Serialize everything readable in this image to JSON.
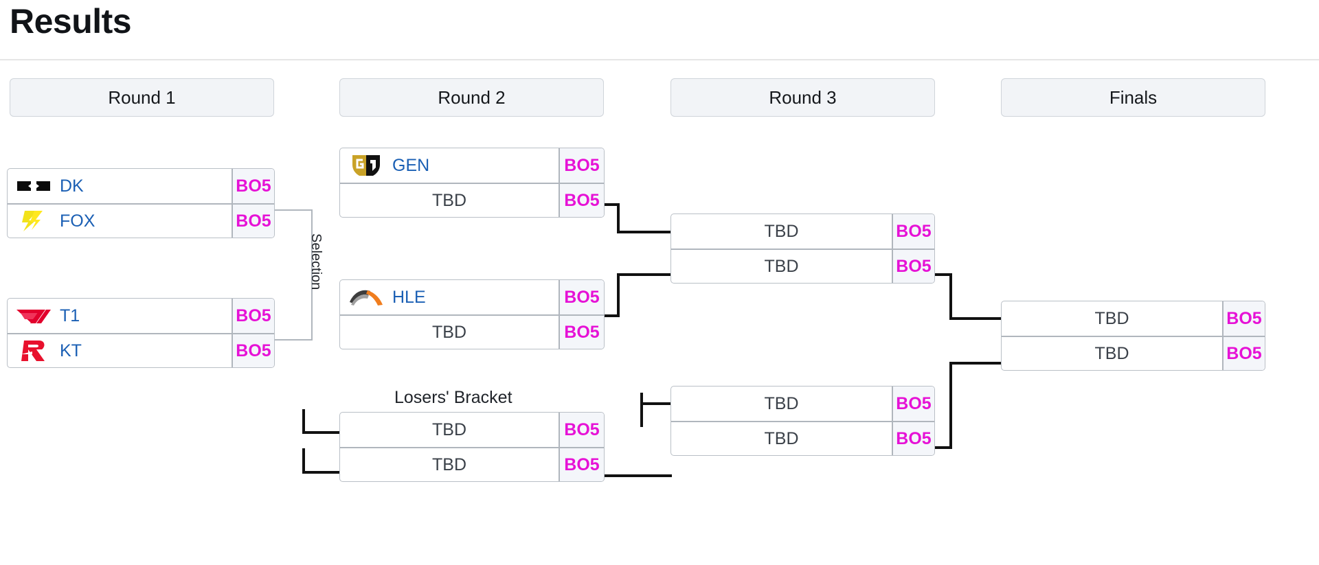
{
  "page": {
    "title": "Results"
  },
  "rounds": [
    {
      "label": "Round 1"
    },
    {
      "label": "Round 2"
    },
    {
      "label": "Round 3"
    },
    {
      "label": "Finals"
    }
  ],
  "labels": {
    "selection": "Selection",
    "losers_bracket": "Losers' Bracket",
    "tbd": "TBD"
  },
  "colors": {
    "score_text": "#e612d6",
    "team_link": "#1a5fb4",
    "tbd_text": "#3b4149",
    "box_border": "#b9bfc6",
    "score_bg": "#f4f6fa",
    "round_head_bg": "#f2f4f7",
    "connector": "#111111"
  },
  "matches": {
    "r1_m1": {
      "rows": [
        {
          "team": "DK",
          "logo": "dk-logo",
          "score": "BO5"
        },
        {
          "team": "FOX",
          "logo": "fox-logo",
          "score": "BO5"
        }
      ]
    },
    "r1_m2": {
      "rows": [
        {
          "team": "T1",
          "logo": "t1-logo",
          "score": "BO5"
        },
        {
          "team": "KT",
          "logo": "kt-logo",
          "score": "BO5"
        }
      ]
    },
    "r2_m1": {
      "rows": [
        {
          "team": "GEN",
          "logo": "gen-logo",
          "score": "BO5"
        },
        {
          "team": "TBD",
          "logo": null,
          "score": "BO5"
        }
      ]
    },
    "r2_m2": {
      "rows": [
        {
          "team": "HLE",
          "logo": "hle-logo",
          "score": "BO5"
        },
        {
          "team": "TBD",
          "logo": null,
          "score": "BO5"
        }
      ]
    },
    "r2_losers": {
      "rows": [
        {
          "team": "TBD",
          "logo": null,
          "score": "BO5"
        },
        {
          "team": "TBD",
          "logo": null,
          "score": "BO5"
        }
      ]
    },
    "r3_m1": {
      "rows": [
        {
          "team": "TBD",
          "logo": null,
          "score": "BO5"
        },
        {
          "team": "TBD",
          "logo": null,
          "score": "BO5"
        }
      ]
    },
    "r3_m2": {
      "rows": [
        {
          "team": "TBD",
          "logo": null,
          "score": "BO5"
        },
        {
          "team": "TBD",
          "logo": null,
          "score": "BO5"
        }
      ]
    },
    "finals": {
      "rows": [
        {
          "team": "TBD",
          "logo": null,
          "score": "BO5"
        },
        {
          "team": "TBD",
          "logo": null,
          "score": "BO5"
        }
      ]
    }
  }
}
